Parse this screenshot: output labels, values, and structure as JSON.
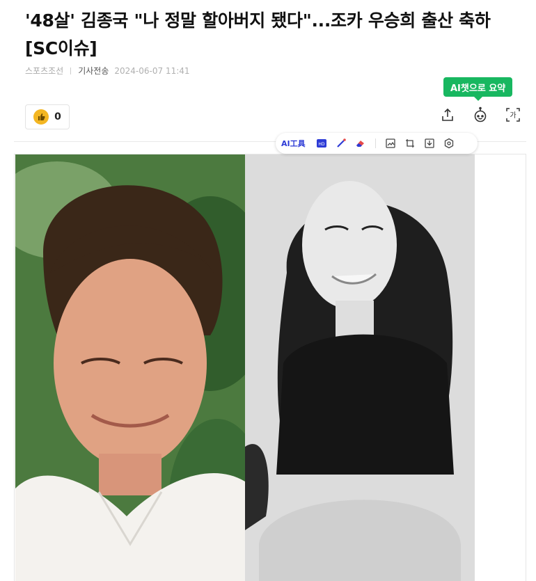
{
  "article": {
    "headline": "'48살' 김종국 \"나 정말 할아버지 됐다\"...조카 우승희 출산 축하 [SC이슈]",
    "source": "스포츠조선",
    "kind": "기사전송",
    "date": "2024-06-07 11:41"
  },
  "reaction": {
    "count": "0",
    "icon": "thumbs-up-coin-icon"
  },
  "ai_chat": {
    "label": "AI챗으로 요약",
    "color": "#18b760"
  },
  "tools": {
    "share_icon": "share-icon",
    "summary_icon": "robot-icon",
    "font_icon": "font-size-icon",
    "font_glyph": "가"
  },
  "photo_toolbar": {
    "ai_tools_label": "AI工具",
    "icons": [
      "hd-icon",
      "brush-icon",
      "eraser-icon",
      "image-edit-icon",
      "crop-icon",
      "download-icon",
      "settings-icon"
    ]
  },
  "photos": [
    {
      "name": "photo-kim-jongkook",
      "style": "color"
    },
    {
      "name": "photo-woo-seunghee",
      "style": "grayscale"
    }
  ]
}
